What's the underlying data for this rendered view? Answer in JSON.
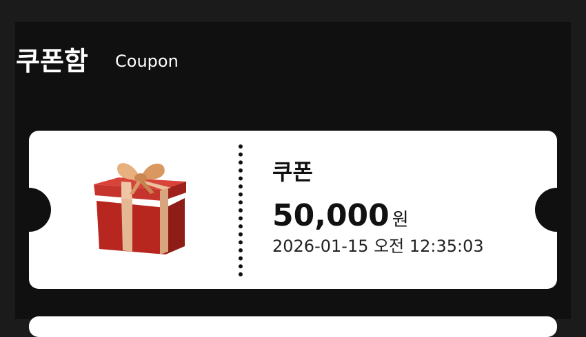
{
  "header": {
    "title": "쿠폰함",
    "subtitle": "Coupon"
  },
  "coupons": [
    {
      "icon": "gift-box-icon",
      "name": "쿠폰",
      "amount": "50,000",
      "unit": "원",
      "issued_at": "2026-01-15 오전 12:35:03"
    }
  ],
  "colors": {
    "background": "#101010",
    "card": "#ffffff",
    "gift_box": "#c8312b",
    "ribbon": "#e2b48c"
  }
}
